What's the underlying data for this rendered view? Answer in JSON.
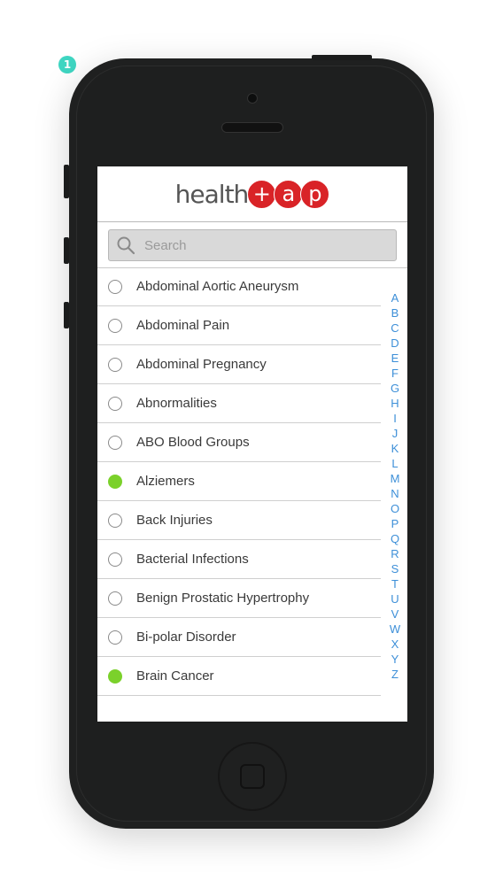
{
  "badge": "1",
  "logo": {
    "text": "health",
    "circles": [
      "+",
      "a",
      "p"
    ]
  },
  "search": {
    "placeholder": "Search",
    "value": ""
  },
  "items": [
    {
      "label": "Abdominal Aortic Aneurysm",
      "selected": false
    },
    {
      "label": "Abdominal Pain",
      "selected": false
    },
    {
      "label": "Abdominal Pregnancy",
      "selected": false
    },
    {
      "label": "Abnormalities",
      "selected": false
    },
    {
      "label": "ABO Blood Groups",
      "selected": false
    },
    {
      "label": "Alziemers",
      "selected": true
    },
    {
      "label": "Back Injuries",
      "selected": false
    },
    {
      "label": "Bacterial Infections",
      "selected": false
    },
    {
      "label": "Benign Prostatic Hypertrophy",
      "selected": false
    },
    {
      "label": "Bi-polar Disorder",
      "selected": false
    },
    {
      "label": "Brain Cancer",
      "selected": true
    }
  ],
  "alphabet": [
    "A",
    "B",
    "C",
    "D",
    "E",
    "F",
    "G",
    "H",
    "I",
    "J",
    "K",
    "L",
    "M",
    "N",
    "O",
    "P",
    "Q",
    "R",
    "S",
    "T",
    "U",
    "V",
    "W",
    "X",
    "Y",
    "Z"
  ],
  "colors": {
    "brand": "#d92327",
    "selected": "#7bd12b",
    "index_link": "#3d8fd8"
  }
}
